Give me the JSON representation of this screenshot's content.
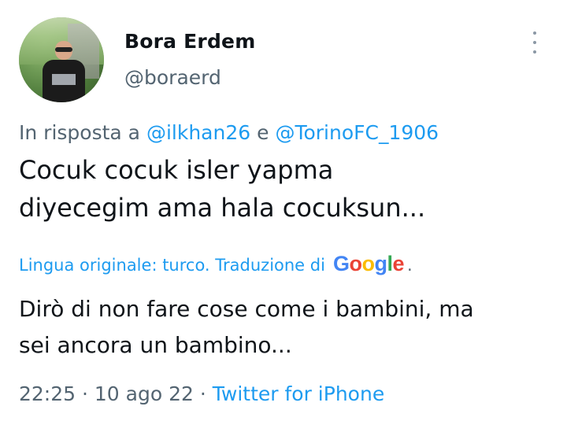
{
  "user": {
    "display_name": "Bora Erdem",
    "handle": "@boraerd"
  },
  "reply_context": {
    "prefix": "In risposta a ",
    "mention1": "@ilkhan26",
    "joiner": " e ",
    "mention2": "@TorinoFC_1906"
  },
  "tweet": {
    "line1": "Cocuk cocuk isler yapma",
    "line2": "diyecegim ama hala cocuksun..."
  },
  "translation_notice": {
    "text": "Lingua originale: turco. Traduzione di",
    "google_letters": [
      "G",
      "o",
      "o",
      "g",
      "l",
      "e"
    ],
    "suffix": "."
  },
  "translation": {
    "line1": "Dirò di non fare cose come i bambini, ma",
    "line2": "sei ancora un bambino..."
  },
  "meta": {
    "time": "22:25",
    "sep1": " · ",
    "date": "10 ago 22",
    "sep2": " · ",
    "source": "Twitter for iPhone"
  },
  "icons": {
    "more": "more-vertical-icon"
  },
  "colors": {
    "link": "#1d9bf0",
    "secondary": "#536471",
    "text": "#0f1419"
  }
}
